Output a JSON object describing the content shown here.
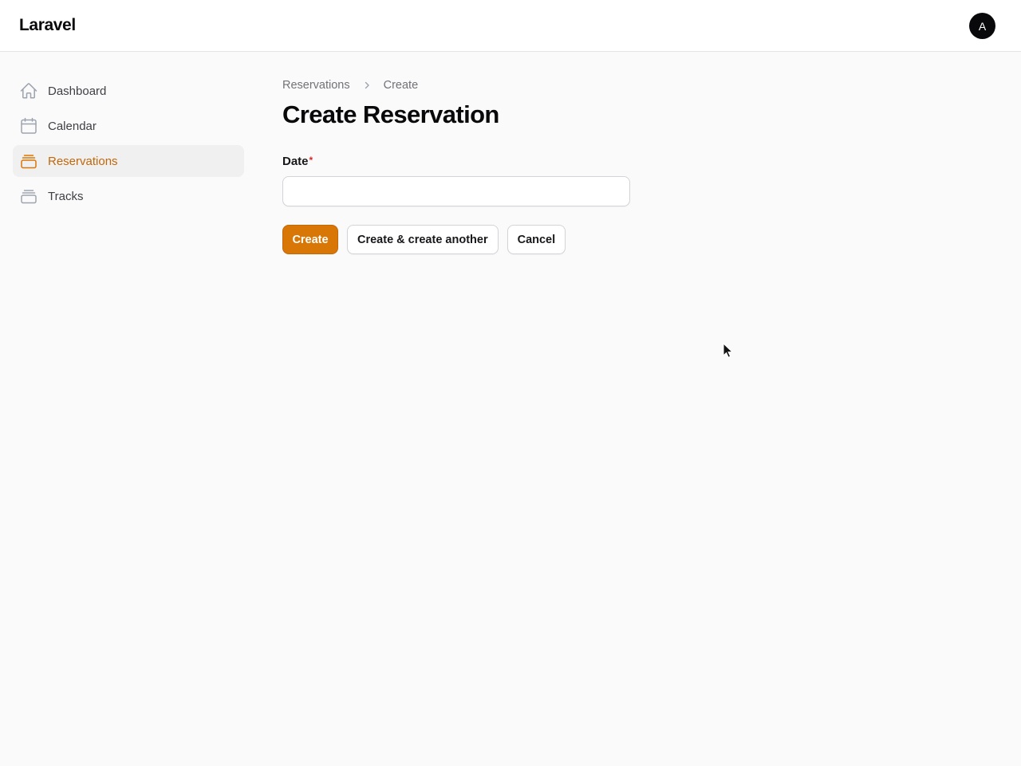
{
  "app": {
    "brand": "Laravel",
    "avatar_initial": "A"
  },
  "sidebar": {
    "items": [
      {
        "label": "Dashboard",
        "icon": "home-icon",
        "active": false
      },
      {
        "label": "Calendar",
        "icon": "calendar-icon",
        "active": false
      },
      {
        "label": "Reservations",
        "icon": "rectangle-stack-icon",
        "active": true
      },
      {
        "label": "Tracks",
        "icon": "rectangle-stack-icon",
        "active": false
      }
    ]
  },
  "breadcrumb": {
    "parent": "Reservations",
    "current": "Create"
  },
  "page": {
    "title": "Create Reservation"
  },
  "form": {
    "date": {
      "label": "Date",
      "required_marker": "*",
      "value": "",
      "placeholder": ""
    }
  },
  "actions": {
    "create_label": "Create",
    "create_another_label": "Create & create another",
    "cancel_label": "Cancel"
  },
  "colors": {
    "accent": "#d97706",
    "active_text": "#c2670a",
    "required": "#dc2626"
  }
}
